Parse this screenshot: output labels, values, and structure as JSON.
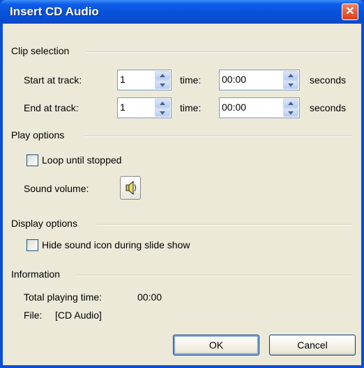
{
  "window": {
    "title": "Insert CD Audio",
    "close_glyph": "✕"
  },
  "clip": {
    "group": "Clip selection",
    "start_label": "Start at track:",
    "start_track": "1",
    "start_time_label": "time:",
    "start_time": "00:00",
    "start_units": "seconds",
    "end_label": "End at track:",
    "end_track": "1",
    "end_time_label": "time:",
    "end_time": "00:00",
    "end_units": "seconds"
  },
  "play": {
    "group": "Play options",
    "loop_label": "Loop until stopped",
    "loop_checked": false,
    "volume_label": "Sound volume:",
    "volume_icon": "speaker-icon"
  },
  "display": {
    "group": "Display options",
    "hide_label": "Hide sound icon during slide show",
    "hide_checked": false
  },
  "info": {
    "group": "Information",
    "total_label": "Total playing time:",
    "total_value": "00:00",
    "file_label": "File:",
    "file_value": "[CD Audio]"
  },
  "buttons": {
    "ok": "OK",
    "cancel": "Cancel"
  },
  "colors": {
    "titlebar": "#0750d8",
    "face": "#ece9d8",
    "close": "#d9401c"
  }
}
